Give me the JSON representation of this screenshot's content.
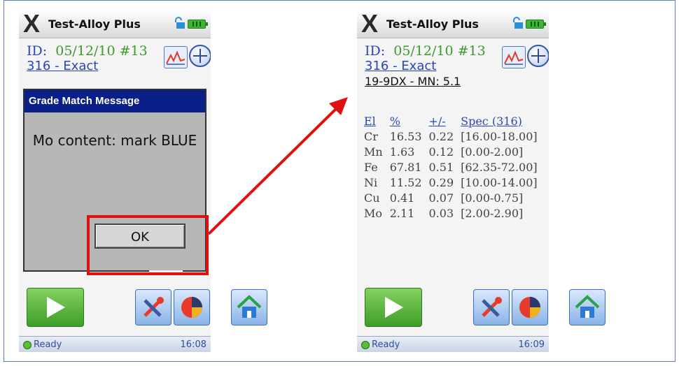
{
  "left_screen": {
    "app_title": "Test-Alloy Plus",
    "id_label": "ID:",
    "id_value": "05/12/10 #13",
    "grade": "316 - Exact",
    "dialog": {
      "title": "Grade Match Message",
      "message": "Mo content: mark BLUE",
      "ok_label": "OK"
    },
    "status": "Ready",
    "time": "16:08"
  },
  "right_screen": {
    "app_title": "Test-Alloy Plus",
    "id_label": "ID:",
    "id_value": "05/12/10 #13",
    "grade": "316 - Exact",
    "match": "19-9DX - MN: 5.1",
    "table": {
      "headers": [
        "El",
        "%",
        "+/-",
        "Spec (316)"
      ],
      "rows": [
        [
          "Cr",
          "16.53",
          "0.22",
          "[16.00-18.00]"
        ],
        [
          "Mn",
          "1.63",
          "0.12",
          "[0.00-2.00]"
        ],
        [
          "Fe",
          "67.81",
          "0.51",
          "[62.35-72.00]"
        ],
        [
          "Ni",
          "11.52",
          "0.29",
          "[10.00-14.00]"
        ],
        [
          "Cu",
          "0.41",
          "0.07",
          "[0.00-0.75]"
        ],
        [
          "Mo",
          "2.11",
          "0.03",
          "[2.00-2.90]"
        ]
      ]
    },
    "status": "Ready",
    "time": "16:09"
  },
  "colors": {
    "highlight": "#e01010",
    "dialog_header": "#0a1f88",
    "link_blue": "#2a46b6",
    "id_green": "#3a9a2a"
  },
  "icons": [
    "x-logo-icon",
    "lock-icon",
    "battery-icon",
    "spectrum-plot-icon",
    "plus-icon",
    "play-icon",
    "tools-icon",
    "pie-chart-icon",
    "home-icon",
    "status-dot-icon"
  ]
}
